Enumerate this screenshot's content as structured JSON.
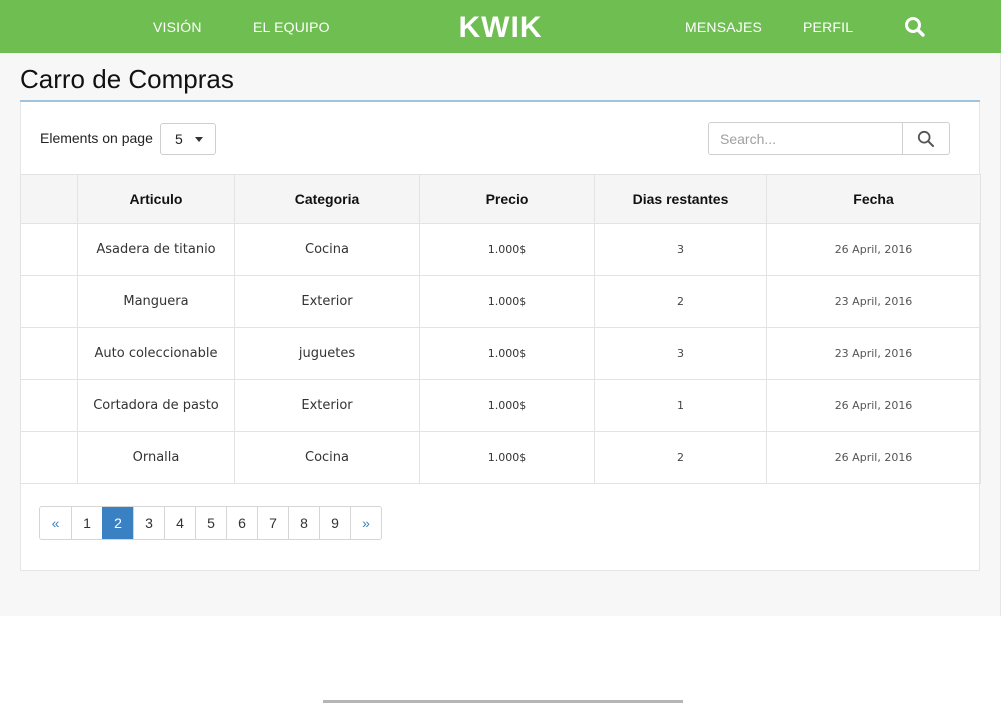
{
  "colors": {
    "nav_bg": "#6fbe52",
    "accent_blue": "#3a81c4",
    "title_rule": "#9ec3dd"
  },
  "nav": {
    "brand": "KWIK",
    "links": [
      "VISIÓN",
      "EL EQUIPO",
      "MENSAJES",
      "PERFIL"
    ],
    "search_icon": "search-icon"
  },
  "page": {
    "title": "Carro de Compras"
  },
  "controls": {
    "elements_label": "Elements on page",
    "elements_value": "5",
    "search_placeholder": "Search...",
    "search_value": ""
  },
  "table": {
    "columns": [
      "",
      "Articulo",
      "Categoria",
      "Precio",
      "Dias restantes",
      "Fecha"
    ],
    "rows": [
      {
        "articulo": "Asadera de titanio",
        "categoria": "Cocina",
        "precio": "1.000$",
        "dias": "3",
        "fecha": "26 April, 2016"
      },
      {
        "articulo": "Manguera",
        "categoria": "Exterior",
        "precio": "1.000$",
        "dias": "2",
        "fecha": "23 April, 2016"
      },
      {
        "articulo": "Auto coleccionable",
        "categoria": "juguetes",
        "precio": "1.000$",
        "dias": "3",
        "fecha": "23 April, 2016"
      },
      {
        "articulo": "Cortadora de pasto",
        "categoria": "Exterior",
        "precio": "1.000$",
        "dias": "1",
        "fecha": "26 April, 2016"
      },
      {
        "articulo": "Ornalla",
        "categoria": "Cocina",
        "precio": "1.000$",
        "dias": "2",
        "fecha": "26 April, 2016"
      }
    ]
  },
  "pagination": {
    "prev": "«",
    "pages": [
      "1",
      "2",
      "3",
      "4",
      "5",
      "6",
      "7",
      "8",
      "9"
    ],
    "next": "»",
    "active_page": "2"
  }
}
